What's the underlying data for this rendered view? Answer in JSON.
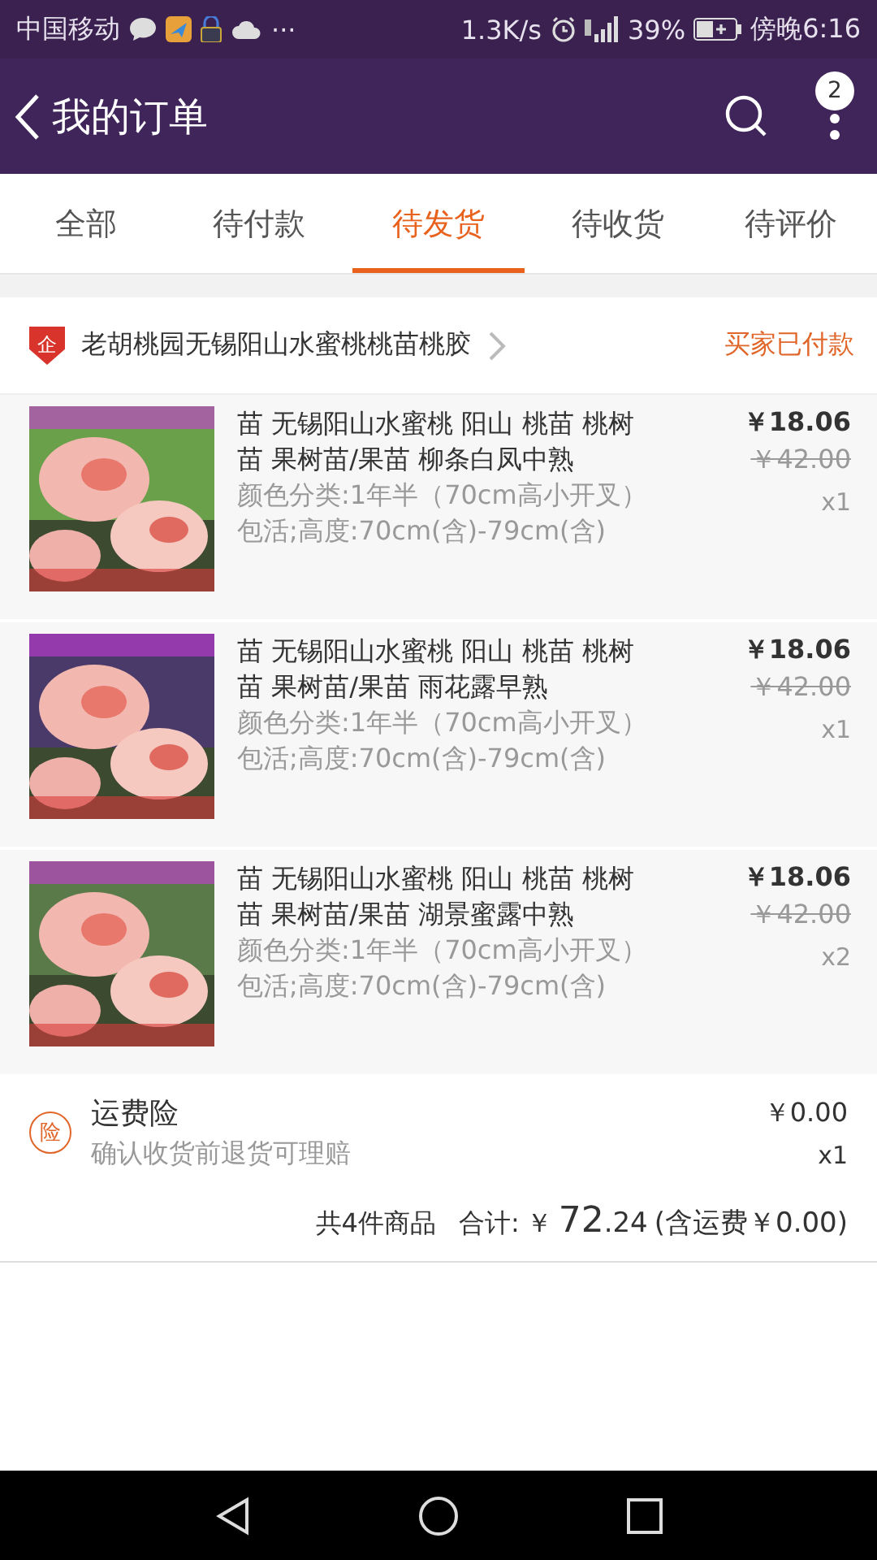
{
  "status_bar": {
    "carrier": "中国移动",
    "more": "···",
    "speed": "1.3K/s",
    "battery": "39%",
    "time": "傍晚6:16"
  },
  "header": {
    "title": "我的订单",
    "badge": "2"
  },
  "tabs": [
    {
      "label": "全部",
      "selected": false
    },
    {
      "label": "待付款",
      "selected": false
    },
    {
      "label": "待发货",
      "selected": true
    },
    {
      "label": "待收货",
      "selected": false
    },
    {
      "label": "待评价",
      "selected": false
    }
  ],
  "order": {
    "shop": "老胡桃园无锡阳山水蜜桃桃苗桃胶",
    "shop_badge": "企",
    "status": "买家已付款",
    "items": [
      {
        "title": "苗 无锡阳山水蜜桃 阳山 桃苗 桃树苗 果树苗/果苗 柳条白凤中熟",
        "spec": "颜色分类:1年半（70cm高小开叉）包活;高度:70cm(含)-79cm(含)",
        "price": "￥18.06",
        "original_price": "￥42.00",
        "qty": "x1"
      },
      {
        "title": "苗 无锡阳山水蜜桃 阳山 桃苗 桃树苗 果树苗/果苗 雨花露早熟",
        "spec": "颜色分类:1年半（70cm高小开叉）包活;高度:70cm(含)-79cm(含)",
        "price": "￥18.06",
        "original_price": "￥42.00",
        "qty": "x1"
      },
      {
        "title": "苗 无锡阳山水蜜桃 阳山 桃苗 桃树苗 果树苗/果苗 湖景蜜露中熟",
        "spec": "颜色分类:1年半（70cm高小开叉）包活;高度:70cm(含)-79cm(含)",
        "price": "￥18.06",
        "original_price": "￥42.00",
        "qty": "x2"
      }
    ],
    "insurance": {
      "badge": "险",
      "name": "运费险",
      "note": "确认收货前退货可理赔",
      "price": "￥0.00",
      "qty": "x1"
    },
    "summary": {
      "count": "共4件商品",
      "total_label": "合计:",
      "currency": "￥",
      "total_int": "72",
      "total_dec": ".24",
      "shipping": "(含运费￥0.00)"
    }
  }
}
